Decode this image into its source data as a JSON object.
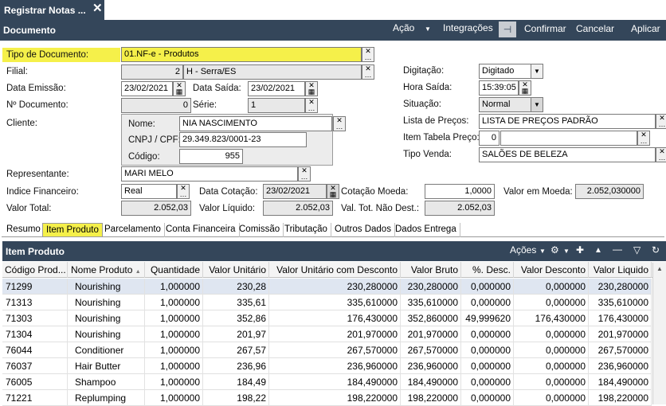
{
  "window": {
    "title_tab": "Registrar Notas ...",
    "close": "✕"
  },
  "toolbar": {
    "title": "Documento",
    "acao": "Ação",
    "integracoes": "Integrações",
    "pin": "⊣",
    "confirmar": "Confirmar",
    "cancelar": "Cancelar",
    "aplicar": "Aplicar"
  },
  "form": {
    "tipo_documento": {
      "label": "Tipo de Documento:",
      "value": "01.NF-e - Produtos"
    },
    "filial": {
      "label": "Filial:",
      "code": "2",
      "value": "H - Serra/ES"
    },
    "data_emissao": {
      "label": "Data Emissão:",
      "value": "23/02/2021"
    },
    "data_saida": {
      "label": "Data Saída:",
      "value": "23/02/2021"
    },
    "n_documento": {
      "label": "Nº Documento:",
      "value": "0"
    },
    "serie": {
      "label": "Série:",
      "value": "1"
    },
    "cliente": {
      "label": "Cliente:"
    },
    "nome": {
      "label": "Nome:",
      "value": "NIA NASCIMENTO"
    },
    "cnpj": {
      "label": "CNPJ / CPF:",
      "value": "29.349.823/0001-23"
    },
    "codigo": {
      "label": "Código:",
      "value": "955"
    },
    "digitacao": {
      "label": "Digitação:",
      "value": "Digitado"
    },
    "hora_saida": {
      "label": "Hora Saída:",
      "value": "15:39:05"
    },
    "situacao": {
      "label": "Situação:",
      "value": "Normal"
    },
    "lista_precos": {
      "label": "Lista de Preços:",
      "value": "LISTA DE PREÇOS PADRÃO"
    },
    "item_tabela": {
      "label": "Item Tabela Preço:",
      "value": "0"
    },
    "tipo_venda": {
      "label": "Tipo Venda:",
      "value": "SALÕES DE BELEZA"
    },
    "representante": {
      "label": "Representante:",
      "value": "MARI MELO"
    },
    "indice_financeiro": {
      "label": "Indice Financeiro:",
      "value": "Real"
    },
    "data_cotacao": {
      "label": "Data Cotação:",
      "value": "23/02/2021"
    },
    "cotacao_moeda": {
      "label": "Cotação Moeda:",
      "value": "1,0000"
    },
    "valor_em_moeda": {
      "label": "Valor em Moeda:",
      "value": "2.052,030000"
    },
    "valor_total": {
      "label": "Valor Total:",
      "value": "2.052,03"
    },
    "valor_liquido": {
      "label": "Valor Líquido:",
      "value": "2.052,03"
    },
    "val_tot_nao_dest": {
      "label": "Val. Tot. Não Dest.:",
      "value": "2.052,03"
    }
  },
  "tabs": [
    "Resumo",
    "Item Produto",
    "Parcelamento",
    "Conta Financeira",
    "Comissão",
    "Tributação",
    "Outros Dados",
    "Dados Entrega"
  ],
  "grid": {
    "title": "Item Produto",
    "acoes": "Ações",
    "columns": [
      "Código Prod...",
      "Nome Produto",
      "Quantidade",
      "Valor Unitário",
      "Valor Unitário com Desconto",
      "Valor Bruto",
      "%. Desc.",
      "Valor Desconto",
      "Valor Liquido"
    ],
    "rows": [
      [
        "71299",
        "Nourishing",
        "1,000000",
        "230,28",
        "230,280000",
        "230,280000",
        "0,000000",
        "0,000000",
        "230,280000"
      ],
      [
        "71313",
        "Nourishing",
        "1,000000",
        "335,61",
        "335,610000",
        "335,610000",
        "0,000000",
        "0,000000",
        "335,610000"
      ],
      [
        "71303",
        "Nourishing",
        "1,000000",
        "352,86",
        "176,430000",
        "352,860000",
        "49,999620",
        "176,430000",
        "176,430000"
      ],
      [
        "71304",
        "Nourishing",
        "1,000000",
        "201,97",
        "201,970000",
        "201,970000",
        "0,000000",
        "0,000000",
        "201,970000"
      ],
      [
        "76044",
        "Conditioner",
        "1,000000",
        "267,57",
        "267,570000",
        "267,570000",
        "0,000000",
        "0,000000",
        "267,570000"
      ],
      [
        "76037",
        "Hair Butter",
        "1,000000",
        "236,96",
        "236,960000",
        "236,960000",
        "0,000000",
        "0,000000",
        "236,960000"
      ],
      [
        "76005",
        "Shampoo",
        "1,000000",
        "184,49",
        "184,490000",
        "184,490000",
        "0,000000",
        "0,000000",
        "184,490000"
      ],
      [
        "71221",
        "Replumping",
        "1,000000",
        "198,22",
        "198,220000",
        "198,220000",
        "0,000000",
        "0,000000",
        "198,220000"
      ]
    ]
  },
  "icons": {
    "ellipsis": "…",
    "calendar": "▦",
    "close_x": "✕",
    "dropdown": "▼",
    "sort_up": "▲",
    "gear": "⚙",
    "plus": "✚",
    "caret_up": "▲",
    "minus": "—",
    "filter": "▽",
    "refresh": "↻",
    "scroll_up": "▲"
  }
}
